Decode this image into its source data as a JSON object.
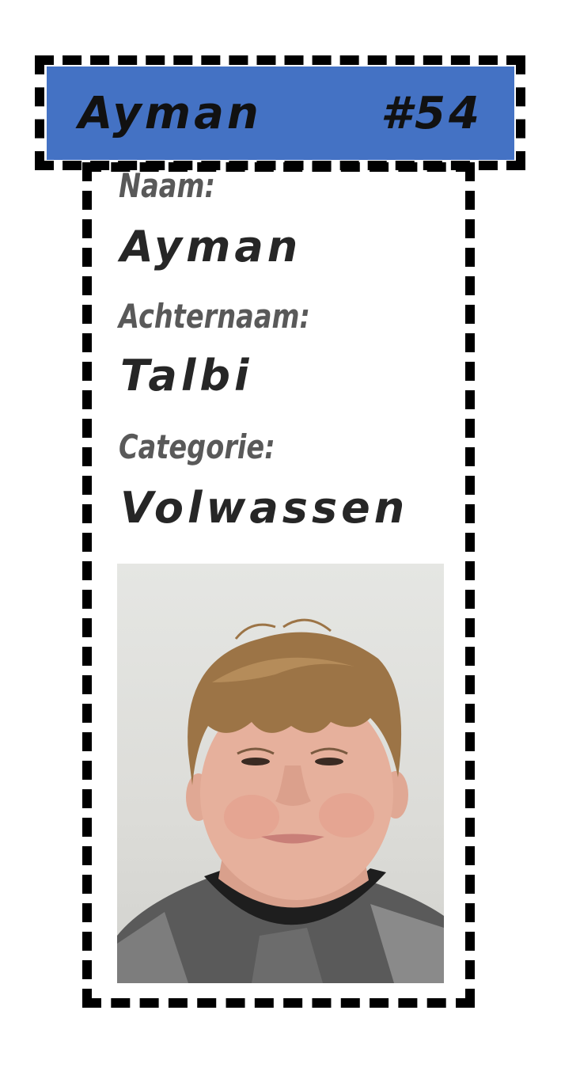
{
  "header": {
    "name": "Ayman",
    "number": "#54",
    "accent_color": "#4472c4"
  },
  "fields": [
    {
      "label": "Naam:",
      "value": "Ayman"
    },
    {
      "label": "Achternaam:",
      "value": "Talbi"
    },
    {
      "label": "Categorie:",
      "value": "Volwassen"
    }
  ],
  "photo": {
    "icon": "portrait-photo"
  }
}
